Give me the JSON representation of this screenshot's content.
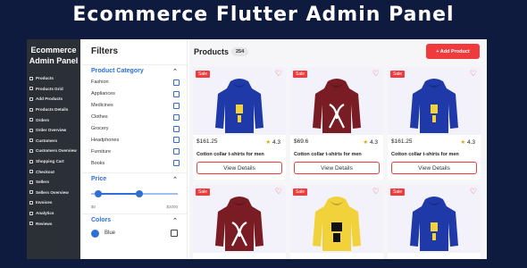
{
  "banner": "Ecommerce Flutter Admin Panel",
  "sidebar": {
    "title": "Ecommerce Admin Panel",
    "items": [
      {
        "label": "Products"
      },
      {
        "label": "Products Grid"
      },
      {
        "label": "Add Products"
      },
      {
        "label": "Products Details"
      },
      {
        "label": "Orders"
      },
      {
        "label": "Order Overview"
      },
      {
        "label": "Customers"
      },
      {
        "label": "Customers Overview"
      },
      {
        "label": "Shopping Cart"
      },
      {
        "label": "Checkout"
      },
      {
        "label": "Sellers"
      },
      {
        "label": "Sellers Overview"
      },
      {
        "label": "Invoices"
      },
      {
        "label": "Analytics"
      },
      {
        "label": "Reviews"
      }
    ]
  },
  "filters": {
    "title": "Filters",
    "category_label": "Product Category",
    "categories": [
      "Fashion",
      "Appliances",
      "Medicines",
      "Clothes",
      "Grocery",
      "Headphones",
      "Furniture",
      "Books"
    ],
    "price_label": "Price",
    "price_min": "$0",
    "price_max": "$2000",
    "price_low_fraction": 0.08,
    "price_high_fraction": 0.55,
    "colors_label": "Colors",
    "color_options": [
      {
        "name": "Blue",
        "hex": "#2d6fd6"
      }
    ]
  },
  "main": {
    "title": "Products",
    "count": "254",
    "add_button": "+ Add Product",
    "sale_badge": "Sale",
    "view_details": "View Details",
    "products": [
      {
        "price": "$161.25",
        "rating": "4.3",
        "name": "Cotton collar t-shirts for men",
        "color": "#1f3aa8",
        "print": "yellow"
      },
      {
        "price": "$69.6",
        "rating": "4.3",
        "name": "Cotton collar t-shirts for men",
        "color": "#7a1c24",
        "print": "white"
      },
      {
        "price": "$161.25",
        "rating": "4.3",
        "name": "Cotton collar t-shirts for men",
        "color": "#1f3aa8",
        "print": "yellow"
      },
      {
        "color": "#7a1c24",
        "print": "white"
      },
      {
        "color": "#f2d23a",
        "print": "black"
      },
      {
        "color": "#1f3aa8",
        "print": "yellow"
      }
    ]
  },
  "colors": {
    "accent": "#ef3b3b",
    "link": "#2d6fd6",
    "sidebar": "#2b2f36",
    "background": "#0f1a3f"
  }
}
